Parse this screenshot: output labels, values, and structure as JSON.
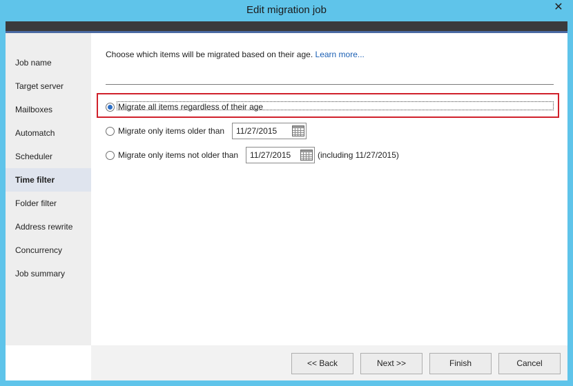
{
  "window": {
    "title": "Edit migration job",
    "close_glyph": "✕"
  },
  "sidebar": {
    "items": [
      {
        "label": "Job name"
      },
      {
        "label": "Target server"
      },
      {
        "label": "Mailboxes"
      },
      {
        "label": "Automatch"
      },
      {
        "label": "Scheduler"
      },
      {
        "label": "Time filter",
        "active": true
      },
      {
        "label": "Folder filter"
      },
      {
        "label": "Address rewrite"
      },
      {
        "label": "Concurrency"
      },
      {
        "label": "Job summary"
      }
    ]
  },
  "content": {
    "intro": "Choose which items will be migrated based on their age.",
    "learn_more": "Learn more...",
    "options": [
      {
        "label": "Migrate all items regardless of their age",
        "selected": true
      },
      {
        "label": "Migrate only items older than",
        "selected": false,
        "date": "11/27/2015"
      },
      {
        "label": "Migrate only items not older than",
        "selected": false,
        "date": "11/27/2015",
        "suffix": "(including 11/27/2015)"
      }
    ],
    "highlight_color": "#d0202a"
  },
  "footer": {
    "back": "<< Back",
    "next": "Next >>",
    "finish": "Finish",
    "cancel": "Cancel"
  },
  "icons": {
    "calendar": "calendar-icon",
    "close": "close-icon"
  },
  "colors": {
    "titlebar": "#5fc4ea",
    "accent_link": "#1a5fb4",
    "radio_selected": "#2c6fc7"
  }
}
